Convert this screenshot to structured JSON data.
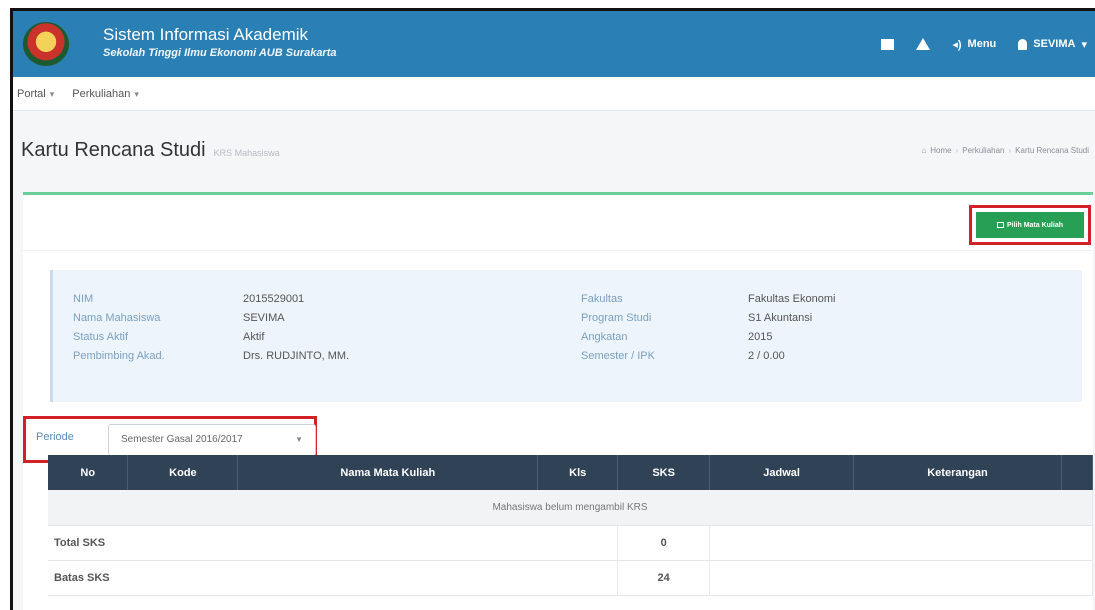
{
  "header": {
    "app_title": "Sistem Informasi Akademik",
    "app_subtitle": "Sekolah Tinggi Ilmu Ekonomi AUB Surakarta",
    "menu_label": "Menu",
    "user_label": "SEVIMA",
    "brand_color": "#2a7fb4"
  },
  "subnav": {
    "items": [
      "Portal",
      "Perkuliahan"
    ]
  },
  "page": {
    "title": "Kartu Rencana Studi",
    "subtitle": "KRS Mahasiswa",
    "breadcrumb": [
      "Home",
      "Perkuliahan",
      "Kartu Rencana Studi"
    ]
  },
  "actions": {
    "pick_course_label": "Pilih Mata Kuliah"
  },
  "student": {
    "left": [
      {
        "label": "NIM",
        "value": "2015529001"
      },
      {
        "label": "Nama Mahasiswa",
        "value": "SEVIMA"
      },
      {
        "label": "Status Aktif",
        "value": "Aktif"
      },
      {
        "label": "Pembimbing Akad.",
        "value": "Drs. RUDJINTO, MM."
      }
    ],
    "right": [
      {
        "label": "Fakultas",
        "value": "Fakultas Ekonomi"
      },
      {
        "label": "Program Studi",
        "value": "S1 Akuntansi"
      },
      {
        "label": "Angkatan",
        "value": "2015"
      },
      {
        "label": "Semester / IPK",
        "value": "2 / 0.00"
      }
    ]
  },
  "period": {
    "label": "Periode",
    "selected": "Semester Gasal 2016/2017"
  },
  "table": {
    "headers": [
      "No",
      "Kode",
      "Nama Mata Kuliah",
      "Kls",
      "SKS",
      "Jadwal",
      "Keterangan"
    ],
    "empty_message": "Mahasiswa belum mengambil KRS",
    "total_label": "Total SKS",
    "total_value": "0",
    "limit_label": "Batas SKS",
    "limit_value": "24"
  }
}
